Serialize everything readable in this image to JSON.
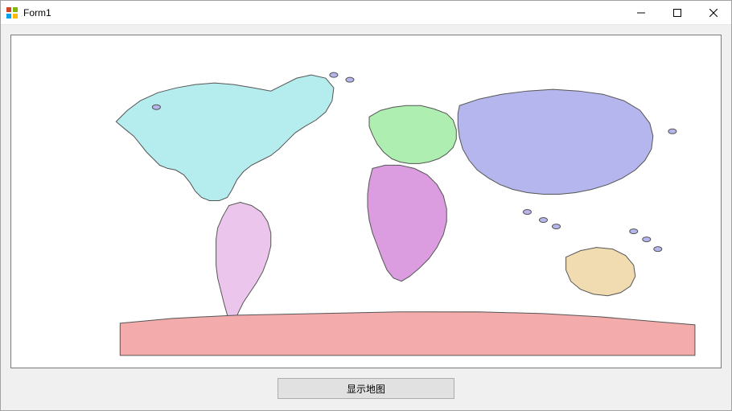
{
  "window": {
    "title": "Form1"
  },
  "buttons": {
    "show_map": "显示地图"
  },
  "map": {
    "continents": [
      {
        "name": "north-america",
        "color": "#b5ecee"
      },
      {
        "name": "south-america",
        "color": "#ecc5ec"
      },
      {
        "name": "europe",
        "color": "#aeeeb0"
      },
      {
        "name": "africa",
        "color": "#db9ce0"
      },
      {
        "name": "asia",
        "color": "#b5b6ee"
      },
      {
        "name": "oceania",
        "color": "#f1dcb1"
      },
      {
        "name": "antarctica",
        "color": "#f4abab"
      }
    ],
    "stroke": "#555555"
  }
}
